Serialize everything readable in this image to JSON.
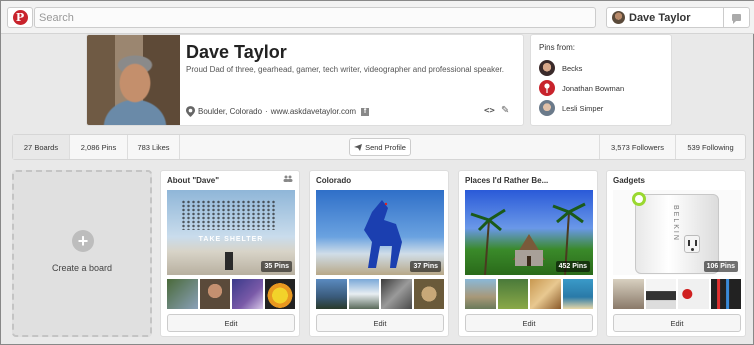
{
  "topbar": {
    "logo_letter": "P",
    "search_placeholder": "Search",
    "user_name": "Dave Taylor"
  },
  "profile": {
    "name": "Dave Taylor",
    "bio": "Proud Dad of three, gearhead, gamer, tech writer, videographer and professional speaker.",
    "location": "Boulder, Colorado",
    "separator": " · ",
    "website": "www.askdavetaylor.com",
    "fb_letter": "f",
    "embed_symbol": "<>"
  },
  "pins_from": {
    "title": "Pins from:",
    "items": [
      {
        "name": "Becks",
        "avatar_color": "#4a3a3a"
      },
      {
        "name": "Jonathan Bowman",
        "avatar_color": "#c8232c"
      },
      {
        "name": "Lesli Simper",
        "avatar_color": "#6b7a8a"
      }
    ]
  },
  "stats": {
    "boards": "27 Boards",
    "pins": "2,086 Pins",
    "likes": "783 Likes",
    "send_profile": "Send Profile",
    "followers": "3,573 Followers",
    "following": "539 Following"
  },
  "create_board": {
    "plus": "+",
    "label": "Create a board"
  },
  "boards": [
    {
      "title": "About \"Dave\"",
      "pin_count": "35 Pins",
      "edit": "Edit",
      "cover_text": "TAKE SHELTER"
    },
    {
      "title": "Colorado",
      "pin_count": "37 Pins",
      "edit": "Edit"
    },
    {
      "title": "Places I'd Rather Be...",
      "pin_count": "452 Pins",
      "edit": "Edit"
    },
    {
      "title": "Gadgets",
      "pin_count": "106 Pins",
      "edit": "Edit",
      "cover_text": "BELKIN"
    }
  ],
  "colors": {
    "brand_red": "#c8232c",
    "background": "#e9e9e9"
  }
}
